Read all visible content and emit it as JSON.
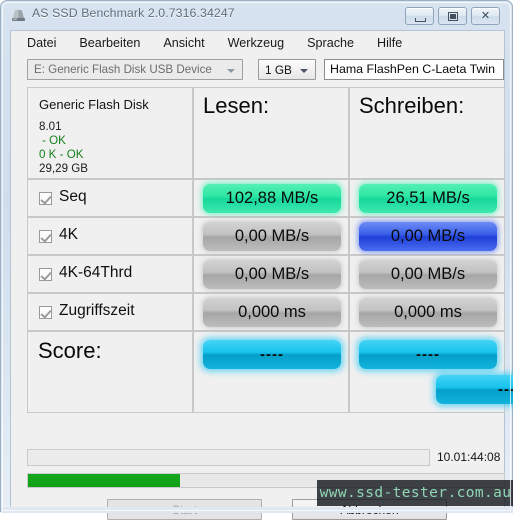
{
  "window": {
    "title": "AS SSD Benchmark 2.0.7316.34247",
    "app_icon": "hard-disk-icon",
    "caption": {
      "minimize": "minimize-icon",
      "restore": "restore-icon",
      "close": "✕"
    }
  },
  "menu": {
    "items": [
      {
        "label": "Datei"
      },
      {
        "label": "Bearbeiten"
      },
      {
        "label": "Ansicht"
      },
      {
        "label": "Werkzeug"
      },
      {
        "label": "Sprache"
      },
      {
        "label": "Hilfe"
      }
    ]
  },
  "toolbar": {
    "drive_select": "E: Generic Flash Disk USB Device",
    "size_select": "1 GB",
    "name_field": "Hama FlashPen C-Laeta Twin"
  },
  "disk_info": {
    "model": "Generic Flash Disk",
    "firmware": "8.01",
    "status_alignment": "- OK",
    "status_offset": "0 K - OK",
    "capacity": "29,29 GB"
  },
  "columns": {
    "read": "Lesen:",
    "write": "Schreiben:"
  },
  "tests": [
    {
      "label": "Seq",
      "checked": true,
      "read": {
        "value": "102,88 MB/s",
        "color": "#2fe6a3",
        "style": "green"
      },
      "write": {
        "value": "26,51 MB/s",
        "color": "#2fe6a3",
        "style": "green"
      }
    },
    {
      "label": "4K",
      "checked": true,
      "read": {
        "value": "0,00 MB/s",
        "color": "#c2c2c2",
        "style": "gray"
      },
      "write": {
        "value": "0,00 MB/s",
        "color": "#3a5fe8",
        "style": "blue"
      }
    },
    {
      "label": "4K-64Thrd",
      "checked": true,
      "read": {
        "value": "0,00 MB/s",
        "color": "#c2c2c2",
        "style": "gray"
      },
      "write": {
        "value": "0,00 MB/s",
        "color": "#c2c2c2",
        "style": "gray"
      }
    },
    {
      "label": "Zugriffszeit",
      "checked": true,
      "read": {
        "value": "0,000 ms",
        "color": "#c2c2c2",
        "style": "gray"
      },
      "write": {
        "value": "0,000 ms",
        "color": "#c2c2c2",
        "style": "gray"
      }
    }
  ],
  "score": {
    "label": "Score:",
    "read": "----",
    "write": "----",
    "total": "----",
    "color": "#19c3ee"
  },
  "status": {
    "message": "",
    "elapsed": "10.01:44:08",
    "progress_percent": 32,
    "progress_color": "#10a216"
  },
  "buttons": {
    "start": "Start",
    "cancel": "Abbrechen"
  },
  "watermark": {
    "text": "www.ssd-tester.com.au"
  }
}
